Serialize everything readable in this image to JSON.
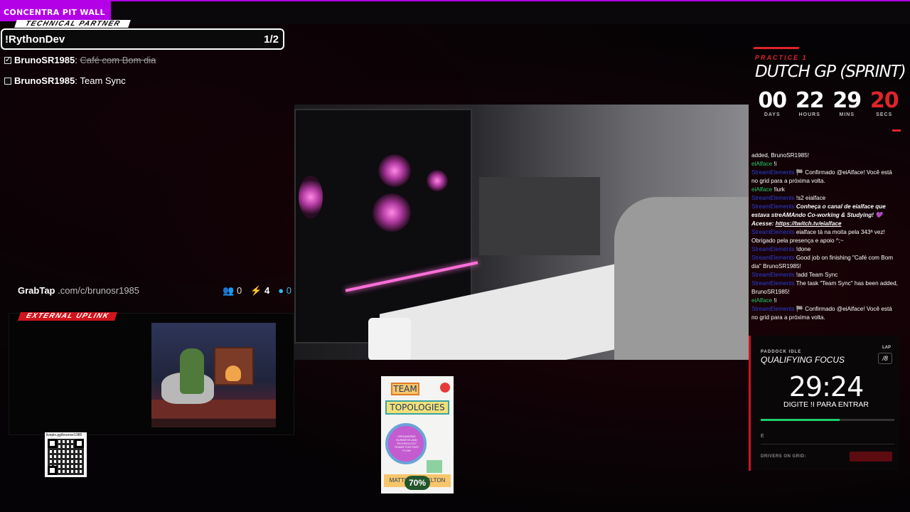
{
  "top_bar": {
    "brand": "CONCENTRA PIT WALL"
  },
  "tasks": {
    "partner_label": "TECHNICAL PARTNER",
    "command": "!RythonDev",
    "counter": "1/2",
    "items": [
      {
        "user": "BrunoSR1985",
        "text": "Café com Bom dia",
        "done": true,
        "check": "✓"
      },
      {
        "user": "BrunoSR1985",
        "text": "Team Sync",
        "done": false,
        "check": ""
      }
    ]
  },
  "grabtap": {
    "logo": "GrabTap",
    "url": ".com/c/brunosr1985",
    "users": "0",
    "bolts": "4",
    "coins": "0"
  },
  "external": {
    "label": "EXTERNAL UPLINK"
  },
  "qr": {
    "label": "livepix.gg/brunosr1985"
  },
  "book": {
    "word1": "TEAM",
    "word2": "TOPOLOGIES",
    "subtitle": "ORGANIZING BUSINESS AND TECHNOLOGY TEAMS FOR FAST FLOW",
    "authors": "MATTHEW SKELTON",
    "progress": "70%"
  },
  "race": {
    "session": "PRACTICE 1",
    "title": "DUTCH GP (SPRINT)",
    "countdown": [
      {
        "value": "00",
        "label": "DAYS"
      },
      {
        "value": "22",
        "label": "HOURS"
      },
      {
        "value": "29",
        "label": "MINS"
      },
      {
        "value": "20",
        "label": "SECS"
      }
    ]
  },
  "chat": [
    {
      "name": "",
      "text": "added, BrunoSR1985!"
    },
    {
      "name": "eiAlface",
      "text": "!i",
      "color": "green"
    },
    {
      "name": "StreamElements",
      "text": "🏁 Confirmado @eiAlface! Você está no grid para a próxima volta.",
      "color": "blue"
    },
    {
      "name": "eiAlface",
      "text": "!lurk",
      "color": "green"
    },
    {
      "name": "StreamElements",
      "text": "!s2 eialface",
      "color": "blue"
    },
    {
      "name": "StreamElements",
      "text": "Conheça o canal de eialface que estava streAMAndo Co-working & Studying! 💜 Acesse:",
      "link": "https://twitch.tv/eialface",
      "color": "blue",
      "italic": true
    },
    {
      "name": "StreamElements",
      "text": "eialface tá na moita pela 343ª vez! Obrigado pela presença e apoio ^;~",
      "color": "blue"
    },
    {
      "name": "StreamElements",
      "text": "!done",
      "color": "blue"
    },
    {
      "name": "StreamElements",
      "text": "Good job on finishing \"Café com Bom dia\" BrunoSR1985!",
      "color": "blue"
    },
    {
      "name": "StreamElements",
      "text": "!add Team Sync",
      "color": "blue"
    },
    {
      "name": "StreamElements",
      "text": "The task \"Team Sync\" has been added, BrunoSR1985!",
      "color": "blue"
    },
    {
      "name": "eiAlface",
      "text": "!i",
      "color": "green"
    },
    {
      "name": "StreamElements",
      "text": "🏁 Confirmado @eiAlface! Você está no grid para a próxima volta.",
      "color": "blue"
    }
  ],
  "focus": {
    "status": "PADDOCK IDLE",
    "lap_label": "LAP",
    "lap": "/8",
    "title": "QUALIFYING FOCUS",
    "time": "29:24",
    "instruction": "DIGITE !I PARA ENTRAR",
    "progress": 0.59,
    "e_label": "E",
    "drivers_label": "DRIVERS ON GRID:"
  },
  "colors": {
    "accent_purple": "#b400e6",
    "accent_red": "#e0242b",
    "green": "#1fce6a"
  }
}
